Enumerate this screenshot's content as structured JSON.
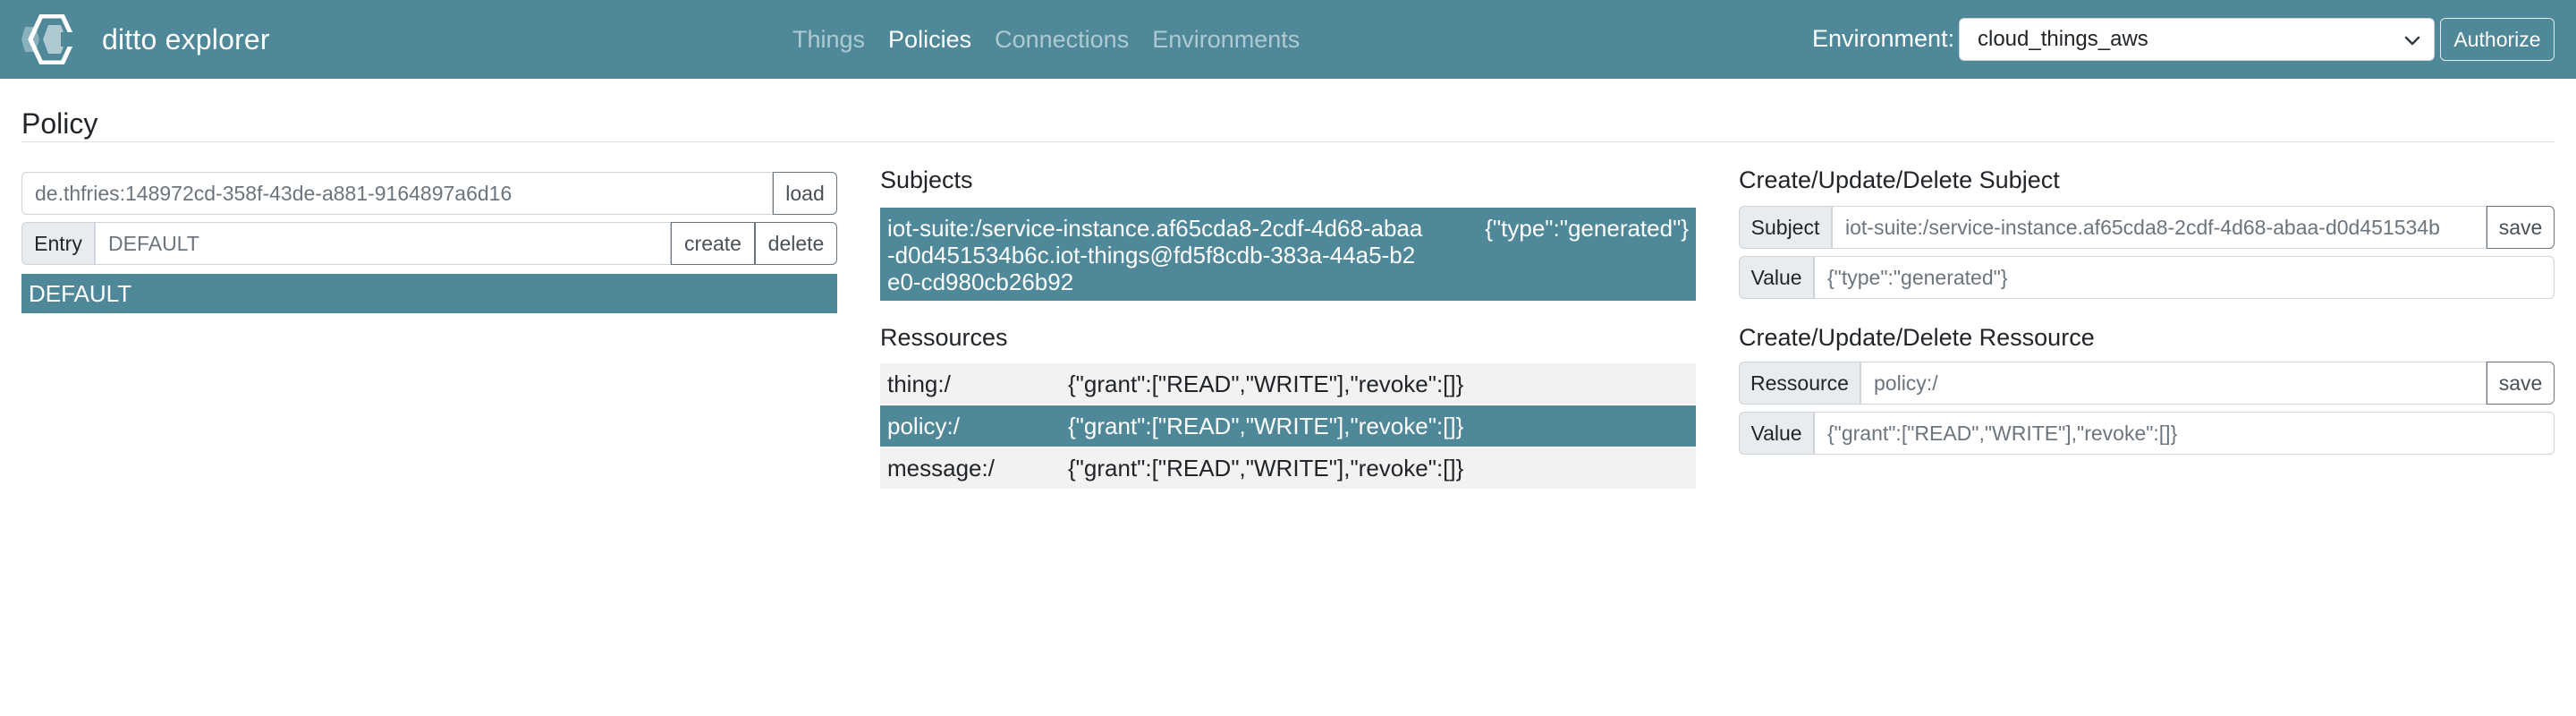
{
  "app": {
    "title": "ditto explorer"
  },
  "nav": {
    "items": [
      {
        "label": "Things",
        "active": false
      },
      {
        "label": "Policies",
        "active": true
      },
      {
        "label": "Connections",
        "active": false
      },
      {
        "label": "Environments",
        "active": false
      }
    ]
  },
  "environment": {
    "label": "Environment:",
    "selected": "cloud_things_aws",
    "authorize_label": "Authorize"
  },
  "page": {
    "title": "Policy"
  },
  "policy": {
    "id_value": "de.thfries:148972cd-358f-43de-a881-9164897a6d16",
    "load_label": "load",
    "entry_label": "Entry",
    "entry_value": "DEFAULT",
    "create_label": "create",
    "delete_label": "delete",
    "entries": [
      "DEFAULT"
    ]
  },
  "subjects": {
    "heading": "Subjects",
    "rows": [
      {
        "key": "iot-suite:/service-instance.af65cda8-2cdf-4d68-abaa-d0d451534b6c.iot-things@fd5f8cdb-383a-44a5-b2e0-cd980cb26b92",
        "value": "{\"type\":\"generated\"}"
      }
    ]
  },
  "resources": {
    "heading": "Ressources",
    "rows": [
      {
        "key": "thing:/",
        "value": "{\"grant\":[\"READ\",\"WRITE\"],\"revoke\":[]}"
      },
      {
        "key": "policy:/",
        "value": "{\"grant\":[\"READ\",\"WRITE\"],\"revoke\":[]}"
      },
      {
        "key": "message:/",
        "value": "{\"grant\":[\"READ\",\"WRITE\"],\"revoke\":[]}"
      }
    ]
  },
  "subject_editor": {
    "heading": "Create/Update/Delete Subject",
    "subject_label": "Subject",
    "subject_value": "iot-suite:/service-instance.af65cda8-2cdf-4d68-abaa-d0d451534b",
    "save_label": "save",
    "value_label": "Value",
    "value_value": "{\"type\":\"generated\"}"
  },
  "resource_editor": {
    "heading": "Create/Update/Delete Ressource",
    "resource_label": "Ressource",
    "resource_value": "policy:/",
    "save_label": "save",
    "value_label": "Value",
    "value_value": "{\"grant\":[\"READ\",\"WRITE\"],\"revoke\":[]}"
  },
  "colors": {
    "navbar": "#4e8899",
    "selected_row": "#4e8899",
    "striped_row": "#f2f2f2"
  },
  "icons": {
    "brand": "ditto-logo-icon",
    "select": "chevron-down-icon"
  }
}
